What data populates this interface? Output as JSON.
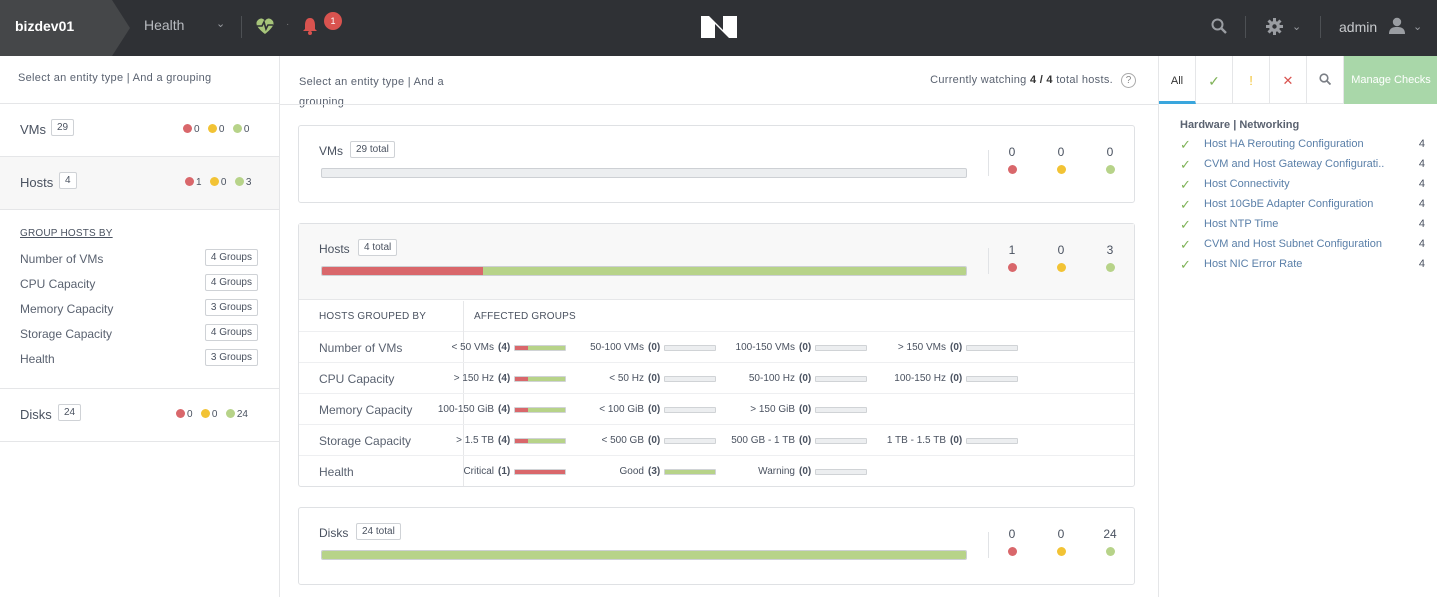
{
  "topbar": {
    "cluster_name": "bizdev01",
    "section": "Health",
    "alert_count": "1",
    "user": "admin"
  },
  "left": {
    "hint": "Select an entity type | And a grouping",
    "entities": [
      {
        "name": "VMs",
        "count": "29",
        "red": "0",
        "yellow": "0",
        "green": "0"
      },
      {
        "name": "Hosts",
        "count": "4",
        "red": "1",
        "yellow": "0",
        "green": "3"
      },
      {
        "name": "Disks",
        "count": "24",
        "red": "0",
        "yellow": "0",
        "green": "24"
      }
    ],
    "group_title": "GROUP HOSTS BY",
    "groups": [
      {
        "name": "Number of VMs",
        "count": "4 Groups"
      },
      {
        "name": "CPU Capacity",
        "count": "4 Groups"
      },
      {
        "name": "Memory Capacity",
        "count": "3 Groups"
      },
      {
        "name": "Storage Capacity",
        "count": "4 Groups"
      },
      {
        "name": "Health",
        "count": "3 Groups"
      }
    ]
  },
  "mid": {
    "hint": "Select an entity type | And a grouping",
    "watch_prefix": "Currently watching",
    "watch_value": "4 / 4",
    "watch_suffix": "total hosts.",
    "help": "?",
    "cards": [
      {
        "title": "VMs",
        "total": "29 total",
        "red": "0",
        "yellow": "0",
        "green": "0",
        "red_fraction": 0,
        "green_fraction": 0
      },
      {
        "title": "Hosts",
        "total": "4 total",
        "red": "1",
        "yellow": "0",
        "green": "3",
        "red_fraction": 0.25,
        "green_fraction": 0.75
      },
      {
        "title": "Disks",
        "total": "24 total",
        "red": "0",
        "yellow": "0",
        "green": "24",
        "red_fraction": 0,
        "green_fraction": 1
      }
    ],
    "grouped_header": "HOSTS GROUPED BY",
    "affected_header": "AFFECTED GROUPS",
    "grouped_rows": [
      {
        "name": "Number of VMs",
        "cells": [
          {
            "label": "< 50 VMs",
            "num": "(4)",
            "red": 0.25,
            "green": 0.75
          },
          {
            "label": "50-100 VMs",
            "num": "(0)",
            "red": 0,
            "green": 0
          },
          {
            "label": "100-150 VMs",
            "num": "(0)",
            "red": 0,
            "green": 0
          },
          {
            "label": "> 150 VMs",
            "num": "(0)",
            "red": 0,
            "green": 0
          }
        ]
      },
      {
        "name": "CPU Capacity",
        "cells": [
          {
            "label": "> 150 Hz",
            "num": "(4)",
            "red": 0.25,
            "green": 0.75
          },
          {
            "label": "< 50 Hz",
            "num": "(0)",
            "red": 0,
            "green": 0
          },
          {
            "label": "50-100 Hz",
            "num": "(0)",
            "red": 0,
            "green": 0
          },
          {
            "label": "100-150 Hz",
            "num": "(0)",
            "red": 0,
            "green": 0
          }
        ]
      },
      {
        "name": "Memory Capacity",
        "cells": [
          {
            "label": "100-150 GiB",
            "num": "(4)",
            "red": 0.25,
            "green": 0.75
          },
          {
            "label": "< 100 GiB",
            "num": "(0)",
            "red": 0,
            "green": 0
          },
          {
            "label": "> 150 GiB",
            "num": "(0)",
            "red": 0,
            "green": 0
          }
        ]
      },
      {
        "name": "Storage Capacity",
        "cells": [
          {
            "label": "> 1.5 TB",
            "num": "(4)",
            "red": 0.25,
            "green": 0.75
          },
          {
            "label": "< 500 GB",
            "num": "(0)",
            "red": 0,
            "green": 0
          },
          {
            "label": "500 GB - 1 TB",
            "num": "(0)",
            "red": 0,
            "green": 0
          },
          {
            "label": "1 TB - 1.5 TB",
            "num": "(0)",
            "red": 0,
            "green": 0
          }
        ]
      },
      {
        "name": "Health",
        "cells": [
          {
            "label": "Critical",
            "num": "(1)",
            "red": 1,
            "green": 0
          },
          {
            "label": "Good",
            "num": "(3)",
            "red": 0,
            "green": 1
          },
          {
            "label": "Warning",
            "num": "(0)",
            "red": 0,
            "green": 0
          }
        ]
      }
    ]
  },
  "right": {
    "tabs": [
      {
        "label": "All",
        "icon": "all"
      },
      {
        "label": "",
        "icon": "check-icon"
      },
      {
        "label": "",
        "icon": "warning-icon"
      },
      {
        "label": "",
        "icon": "error-icon"
      },
      {
        "label": "",
        "icon": "search-icon"
      }
    ],
    "manage_label": "Manage Checks",
    "section_title": "Hardware | Networking",
    "checks": [
      {
        "name": "Host HA Rerouting Configuration",
        "value": "4"
      },
      {
        "name": "CVM and Host Gateway Configurati..",
        "value": "4"
      },
      {
        "name": "Host Connectivity",
        "value": "4"
      },
      {
        "name": "Host 10GbE Adapter Configuration",
        "value": "4"
      },
      {
        "name": "Host NTP Time",
        "value": "4"
      },
      {
        "name": "CVM and Host Subnet Configuration",
        "value": "4"
      },
      {
        "name": "Host NIC Error Rate",
        "value": "4"
      }
    ]
  },
  "colors": {
    "red": "#d9676b",
    "yellow": "#f2c335",
    "green": "#b7d389",
    "accent": "#3aa6dd",
    "manage": "#a9d7a9"
  }
}
